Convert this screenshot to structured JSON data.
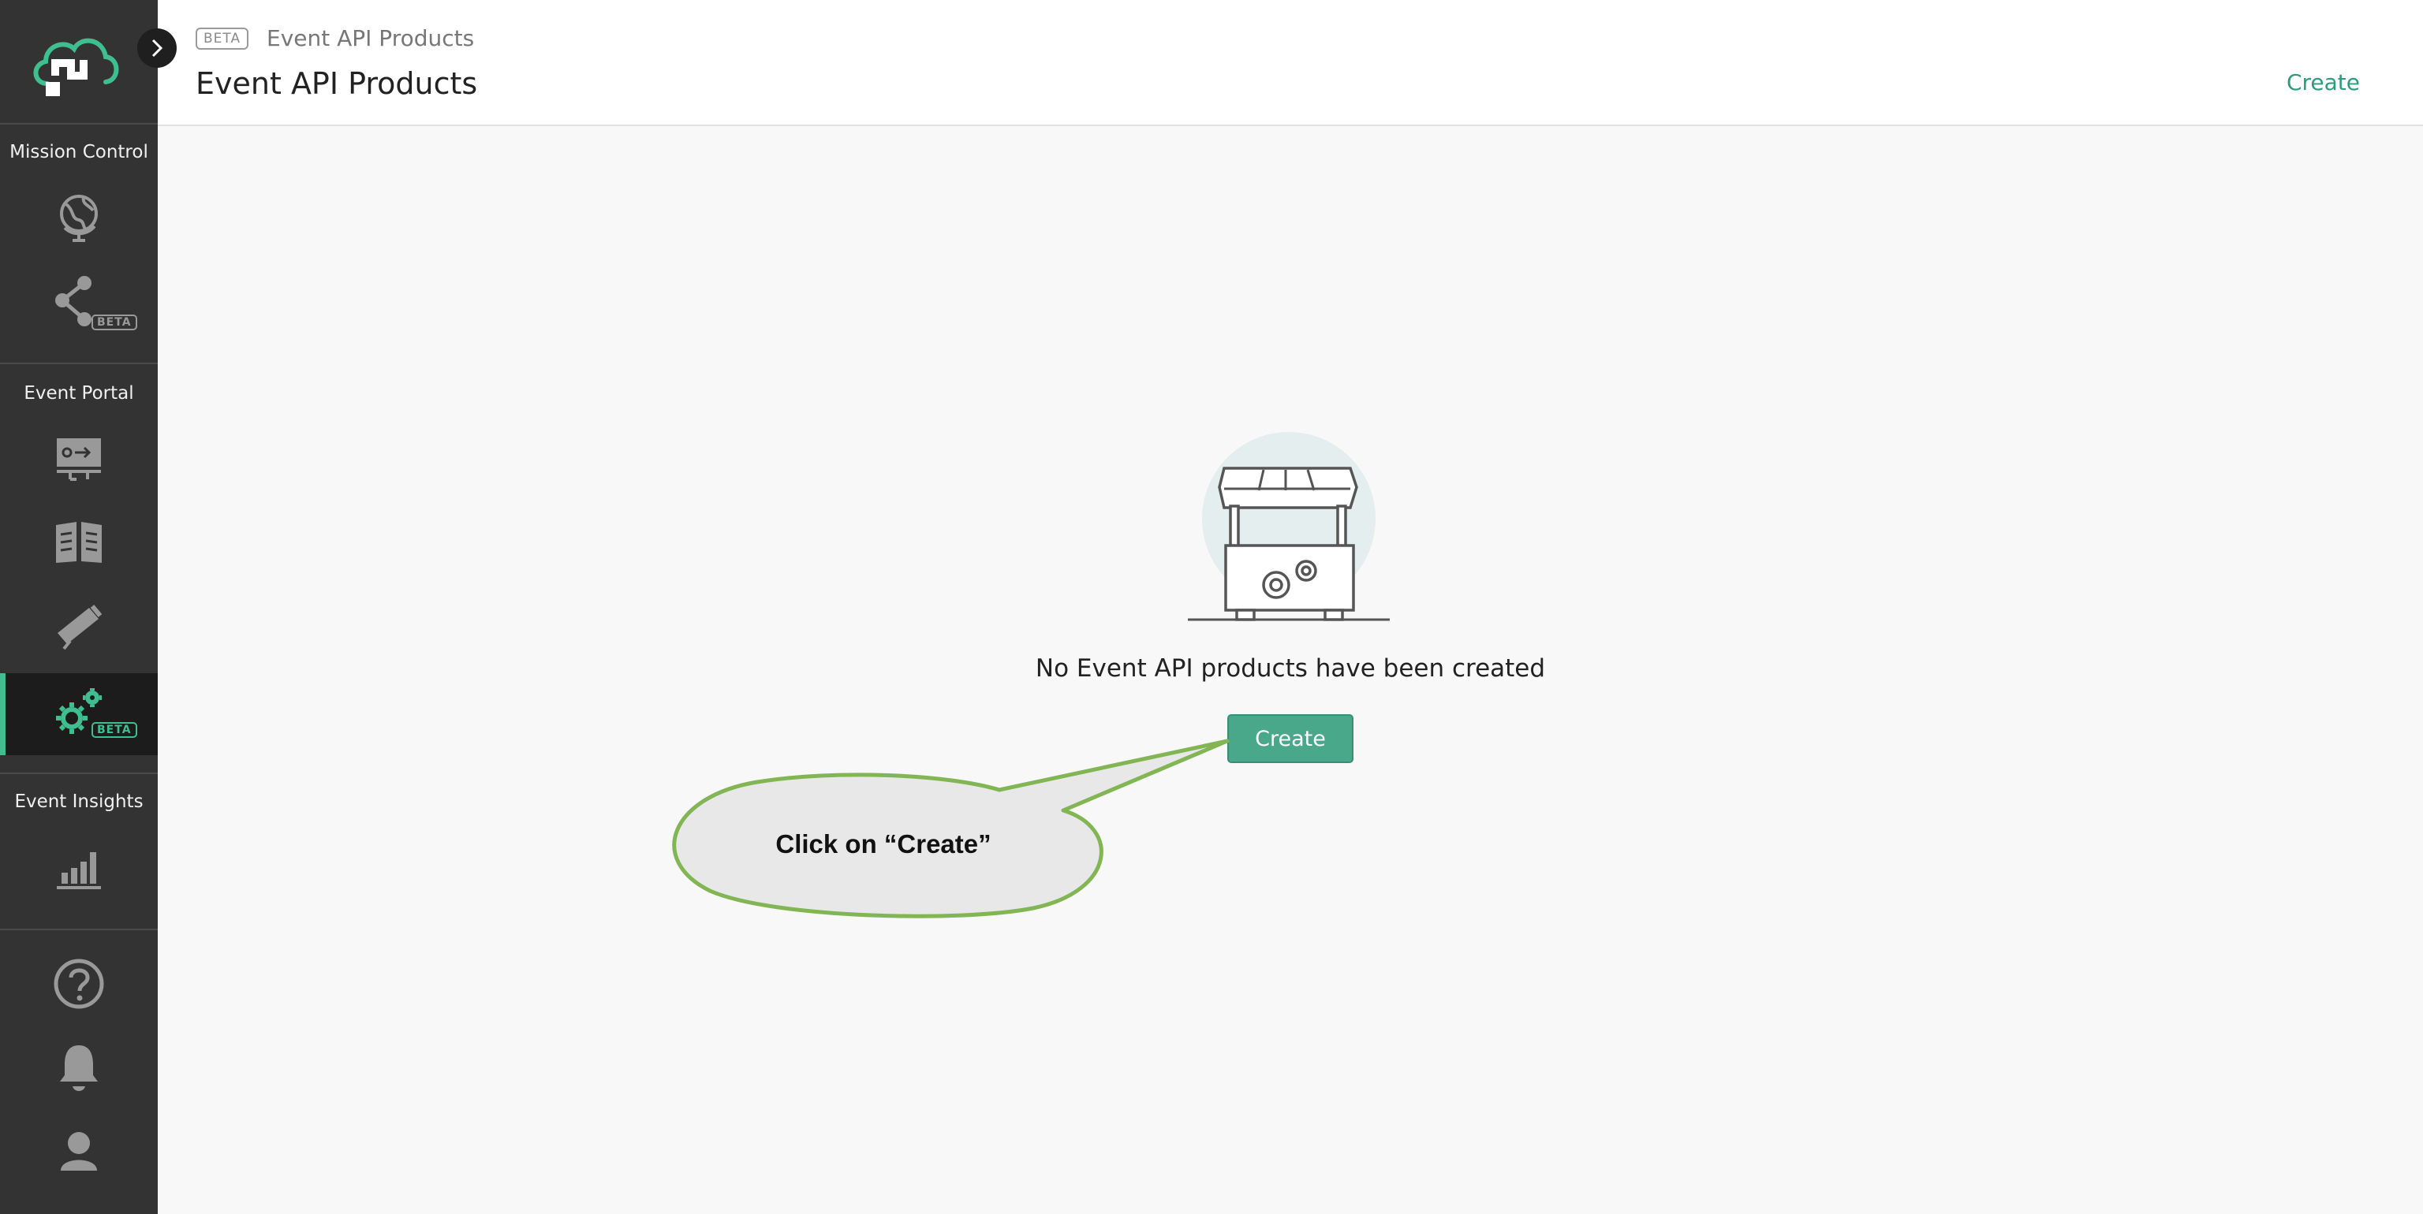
{
  "sidebar": {
    "sections": [
      {
        "label": "Mission Control",
        "items": [
          {
            "icon": "globe-icon"
          },
          {
            "icon": "mesh-network-icon",
            "badge": "BETA"
          }
        ]
      },
      {
        "label": "Event Portal",
        "items": [
          {
            "icon": "designer-board-icon"
          },
          {
            "icon": "catalog-book-icon"
          },
          {
            "icon": "runtime-telescope-icon"
          },
          {
            "icon": "gears-icon",
            "badge": "BETA",
            "active": true
          }
        ]
      },
      {
        "label": "Event Insights",
        "items": [
          {
            "icon": "bar-chart-icon"
          }
        ]
      }
    ],
    "bottom": [
      {
        "icon": "help-icon"
      },
      {
        "icon": "bell-icon"
      },
      {
        "icon": "user-icon"
      }
    ]
  },
  "header": {
    "beta": "BETA",
    "breadcrumb": "Event API Products",
    "title": "Event API Products",
    "create_label": "Create"
  },
  "main": {
    "empty_message": "No Event API products have been created",
    "create_label": "Create"
  },
  "callout": {
    "text": "Click on “Create”"
  },
  "colors": {
    "accent": "#3fbf8f",
    "button": "#4aa88a",
    "sidebar": "#333333",
    "callout_border": "#82b553"
  }
}
